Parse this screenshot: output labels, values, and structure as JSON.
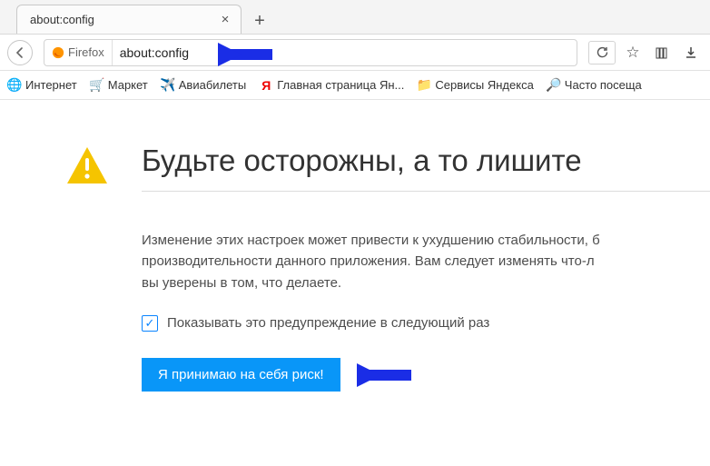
{
  "tab": {
    "title": "about:config"
  },
  "urlbar": {
    "brand_label": "Firefox",
    "url": "about:config"
  },
  "bookmarks": [
    {
      "icon": "globe-icon",
      "glyph": "🌐",
      "label": "Интернет"
    },
    {
      "icon": "cart-icon",
      "glyph": "🛒",
      "label": "Маркет"
    },
    {
      "icon": "plane-icon",
      "glyph": "✈️",
      "label": "Авиабилеты"
    },
    {
      "icon": "yandex-icon",
      "glyph": "Я",
      "label": "Главная страница Ян..."
    },
    {
      "icon": "folder-icon",
      "glyph": "📁",
      "label": "Сервисы Яндекса"
    },
    {
      "icon": "search-icon",
      "glyph": "🔎",
      "label": "Часто посеща"
    }
  ],
  "warning": {
    "title": "Будьте осторожны, а то лишите",
    "body_line1": "Изменение этих настроек может привести к ухудшению стабильности, б",
    "body_line2": "производительности данного приложения. Вам следует изменять что-л",
    "body_line3": "вы уверены в том, что делаете.",
    "checkbox_label": "Показывать это предупреждение в следующий раз",
    "button_label": "Я принимаю на себя риск!"
  },
  "colors": {
    "accent": "#0996f8",
    "warn_yellow": "#f5c400",
    "arrow_blue": "#1a2de6"
  }
}
